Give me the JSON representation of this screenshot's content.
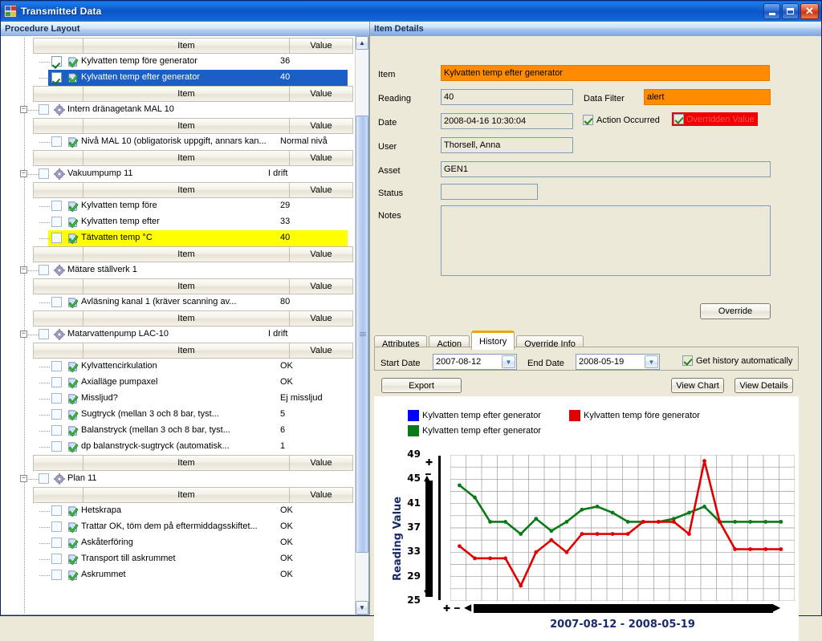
{
  "window": {
    "title": "Transmitted Data",
    "icon": "application-icon",
    "buttons": {
      "minimize": "minimize-button",
      "restore": "restore-button",
      "close": "close-button"
    }
  },
  "left_panel": {
    "header": "Procedure Layout",
    "column_headers": {
      "item": "Item",
      "value": "Value"
    },
    "nodes": [
      {
        "kind": "header"
      },
      {
        "kind": "leaf",
        "checked": true,
        "label": "Kylvatten temp före generator <normal>",
        "value": "36",
        "state": "normal"
      },
      {
        "kind": "leaf",
        "checked": true,
        "label": "Kylvatten temp efter generator <alert>",
        "value": "40",
        "state": "selected"
      },
      {
        "kind": "header"
      },
      {
        "kind": "group",
        "checked": false,
        "label": "Intern dränagetank MAL 10",
        "value": ""
      },
      {
        "kind": "header"
      },
      {
        "kind": "leaf",
        "checked": false,
        "label": "Nivå MAL 10 (obligatorisk uppgift, annars kan...",
        "value": "Normal nivå",
        "state": "normal"
      },
      {
        "kind": "header"
      },
      {
        "kind": "group",
        "checked": false,
        "label": "Vakuumpump 11",
        "value": "I drift"
      },
      {
        "kind": "header"
      },
      {
        "kind": "leaf",
        "checked": false,
        "label": "Kylvatten temp före <normal>",
        "value": "29",
        "state": "normal"
      },
      {
        "kind": "leaf",
        "checked": false,
        "label": "Kylvatten temp efter <normal>",
        "value": "33",
        "state": "normal"
      },
      {
        "kind": "leaf",
        "checked": false,
        "label": "Tätvatten temp °C <warning>",
        "value": "40",
        "state": "warning"
      },
      {
        "kind": "header"
      },
      {
        "kind": "group",
        "checked": false,
        "label": "Mätare ställverk 1",
        "value": ""
      },
      {
        "kind": "header"
      },
      {
        "kind": "leaf",
        "checked": false,
        "label": "Avläsning kanal 1 (kräver scanning av...",
        "value": "80",
        "state": "normal"
      },
      {
        "kind": "header"
      },
      {
        "kind": "group",
        "checked": false,
        "label": "Matarvattenpump LAC-10",
        "value": "I drift"
      },
      {
        "kind": "header"
      },
      {
        "kind": "leaf",
        "checked": false,
        "label": "Kylvattencirkulation <normal>",
        "value": "OK",
        "state": "normal"
      },
      {
        "kind": "leaf",
        "checked": false,
        "label": "Axialläge pumpaxel <normal>",
        "value": "OK",
        "state": "normal"
      },
      {
        "kind": "leaf",
        "checked": false,
        "label": "Missljud? <normal>",
        "value": "Ej missljud",
        "state": "normal"
      },
      {
        "kind": "leaf",
        "checked": false,
        "label": "Sugtryck (mellan 3 och 8 bar, tyst...",
        "value": "5",
        "state": "normal"
      },
      {
        "kind": "leaf",
        "checked": false,
        "label": "Balanstryck  (mellan 3 och 8 bar, tyst...",
        "value": "6",
        "state": "normal"
      },
      {
        "kind": "leaf",
        "checked": false,
        "label": "dp  balanstryck-sugtryck  (automatisk...",
        "value": "1",
        "state": "normal"
      },
      {
        "kind": "header"
      },
      {
        "kind": "group",
        "checked": false,
        "label": "Plan 11",
        "value": ""
      },
      {
        "kind": "header"
      },
      {
        "kind": "leaf",
        "checked": false,
        "label": "Hetskrapa <normal>",
        "value": "OK",
        "state": "normal"
      },
      {
        "kind": "leaf",
        "checked": false,
        "label": "Trattar OK, töm dem på eftermiddagsskiftet...",
        "value": "OK",
        "state": "normal"
      },
      {
        "kind": "leaf",
        "checked": false,
        "label": "Askåterföring <normal>",
        "value": "OK",
        "state": "normal"
      },
      {
        "kind": "leaf",
        "checked": false,
        "label": "Transport till askrummet <normal>",
        "value": "OK",
        "state": "normal"
      },
      {
        "kind": "leaf",
        "checked": false,
        "label": "Askrummet <normal>",
        "value": "OK",
        "state": "normal"
      }
    ],
    "scrollbar": {
      "up": "scroll-up-arrow",
      "down": "scroll-down-arrow"
    }
  },
  "right_panel": {
    "header": "Item Details",
    "fields": {
      "item_label": "Item",
      "item_value": "Kylvatten temp efter generator",
      "reading_label": "Reading",
      "reading_value": "40",
      "data_filter_label": "Data Filter",
      "data_filter_value": "alert",
      "date_label": "Date",
      "date_value": "2008-04-16 10:30:04",
      "user_label": "User",
      "user_value": "Thorsell, Anna",
      "asset_label": "Asset",
      "asset_value": "GEN1",
      "status_label": "Status",
      "status_value": "",
      "notes_label": "Notes",
      "notes_value": ""
    },
    "checkboxes": {
      "action_occurred": {
        "label": "Action Occurred",
        "checked": true
      },
      "overridden_value": {
        "label": "Overridden Value",
        "checked": true,
        "highlight": "#f20000"
      }
    },
    "override_button": "Override",
    "tabs": [
      {
        "label": "Attributes",
        "active": false
      },
      {
        "label": "Action",
        "active": false
      },
      {
        "label": "History",
        "active": true
      },
      {
        "label": "Override Info",
        "active": false
      }
    ],
    "history": {
      "start_date_label": "Start Date",
      "start_date_value": "2007-08-12",
      "end_date_label": "End Date",
      "end_date_value": "2008-05-19",
      "auto_label": "Get history automatically",
      "auto_checked": true,
      "export_button": "Export",
      "view_chart_button": "View Chart",
      "view_details_button": "View Details"
    }
  },
  "chart_data": {
    "type": "line",
    "title": "",
    "xlabel": "",
    "ylabel": "Reading Value",
    "x_caption": "2007-08-12 - 2008-05-19",
    "ylim": [
      25,
      49
    ],
    "yticks": [
      49,
      45,
      41,
      37,
      33,
      29,
      25
    ],
    "grid": true,
    "legend_position": "top",
    "legend": [
      {
        "name": "Kylvatten temp efter generator",
        "color": "#0000ff"
      },
      {
        "name": "Kylvatten temp före generator",
        "color": "#e00000"
      },
      {
        "name": "Kylvatten temp efter generator",
        "color": "#0a7a18"
      }
    ],
    "x": [
      1,
      2,
      3,
      4,
      5,
      6,
      7,
      8,
      9,
      10,
      11,
      12,
      13,
      14,
      15,
      16,
      17,
      18,
      19,
      20,
      21,
      22
    ],
    "series": [
      {
        "name": "Kylvatten temp efter generator",
        "color": "#0a7a18",
        "values": [
          44,
          42,
          38,
          38,
          36,
          38.5,
          36.5,
          38,
          40,
          40.5,
          39.5,
          38,
          38,
          38,
          38.5,
          39.5,
          40.5,
          38,
          38,
          38,
          38,
          38
        ]
      },
      {
        "name": "Kylvatten temp före generator",
        "color": "#e00000",
        "values": [
          34,
          32,
          32,
          32,
          27.5,
          33,
          35,
          33,
          36,
          36,
          36,
          36,
          38,
          38,
          38,
          36,
          48,
          38,
          33.5,
          33.5,
          33.5,
          33.5
        ]
      }
    ]
  }
}
